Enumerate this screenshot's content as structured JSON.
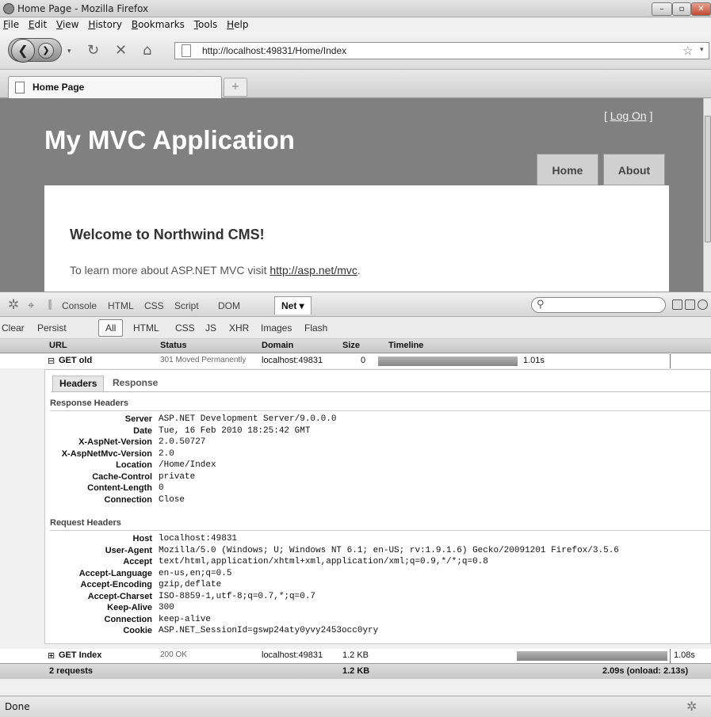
{
  "window": {
    "title": "Home Page - Mozilla Firefox"
  },
  "menu": [
    "File",
    "Edit",
    "View",
    "History",
    "Bookmarks",
    "Tools",
    "Help"
  ],
  "nav": {
    "url": "http://localhost:49831/Home/Index"
  },
  "tabs": [
    {
      "label": "Home Page"
    }
  ],
  "site": {
    "logon_open": "[ ",
    "logon_link": "Log On",
    "logon_close": " ]",
    "title": "My MVC Application",
    "menu_home": "Home",
    "menu_about": "About",
    "welcome": "Welcome to Northwind CMS!",
    "learn_prefix": "To learn more about ASP.NET MVC visit ",
    "learn_link": "http://asp.net/mvc",
    "learn_suffix": "."
  },
  "firebug": {
    "tabs": [
      "Console",
      "HTML",
      "CSS",
      "Script",
      "DOM",
      "Net ▾"
    ],
    "filters": [
      "Clear",
      "Persist",
      "All",
      "HTML",
      "CSS",
      "JS",
      "XHR",
      "Images",
      "Flash"
    ],
    "columns": {
      "url": "URL",
      "status": "Status",
      "domain": "Domain",
      "size": "Size",
      "timeline": "Timeline"
    },
    "requests": [
      {
        "expander": "⊟",
        "url": "GET old",
        "status": "301 Moved Permanently",
        "domain": "localhost:49831",
        "size": "0",
        "time": "1.01s"
      },
      {
        "expander": "⊞",
        "url": "GET Index",
        "status": "200 OK",
        "domain": "localhost:49831",
        "size": "1.2 KB",
        "time": "1.08s"
      }
    ],
    "detail_tabs": [
      "Headers",
      "Response"
    ],
    "response_title": "Response Headers",
    "response_headers": [
      {
        "k": "Server",
        "v": "ASP.NET Development Server/9.0.0.0"
      },
      {
        "k": "Date",
        "v": "Tue, 16 Feb 2010 18:25:42 GMT"
      },
      {
        "k": "X-AspNet-Version",
        "v": "2.0.50727"
      },
      {
        "k": "X-AspNetMvc-Version",
        "v": "2.0"
      },
      {
        "k": "Location",
        "v": "/Home/Index"
      },
      {
        "k": "Cache-Control",
        "v": "private"
      },
      {
        "k": "Content-Length",
        "v": "0"
      },
      {
        "k": "Connection",
        "v": "Close"
      }
    ],
    "request_title": "Request Headers",
    "request_headers": [
      {
        "k": "Host",
        "v": "localhost:49831"
      },
      {
        "k": "User-Agent",
        "v": "Mozilla/5.0 (Windows; U; Windows NT 6.1; en-US; rv:1.9.1.6) Gecko/20091201 Firefox/3.5.6"
      },
      {
        "k": "Accept",
        "v": "text/html,application/xhtml+xml,application/xml;q=0.9,*/*;q=0.8"
      },
      {
        "k": "Accept-Language",
        "v": "en-us,en;q=0.5"
      },
      {
        "k": "Accept-Encoding",
        "v": "gzip,deflate"
      },
      {
        "k": "Accept-Charset",
        "v": "ISO-8859-1,utf-8;q=0.7,*;q=0.7"
      },
      {
        "k": "Keep-Alive",
        "v": "300"
      },
      {
        "k": "Connection",
        "v": "keep-alive"
      },
      {
        "k": "Cookie",
        "v": "ASP.NET_SessionId=gswp24aty0yvy2453occ0yry"
      }
    ],
    "summary": {
      "requests": "2 requests",
      "size": "1.2 KB",
      "time": "2.09s (onload: 2.13s)"
    }
  },
  "status": {
    "text": "Done"
  }
}
